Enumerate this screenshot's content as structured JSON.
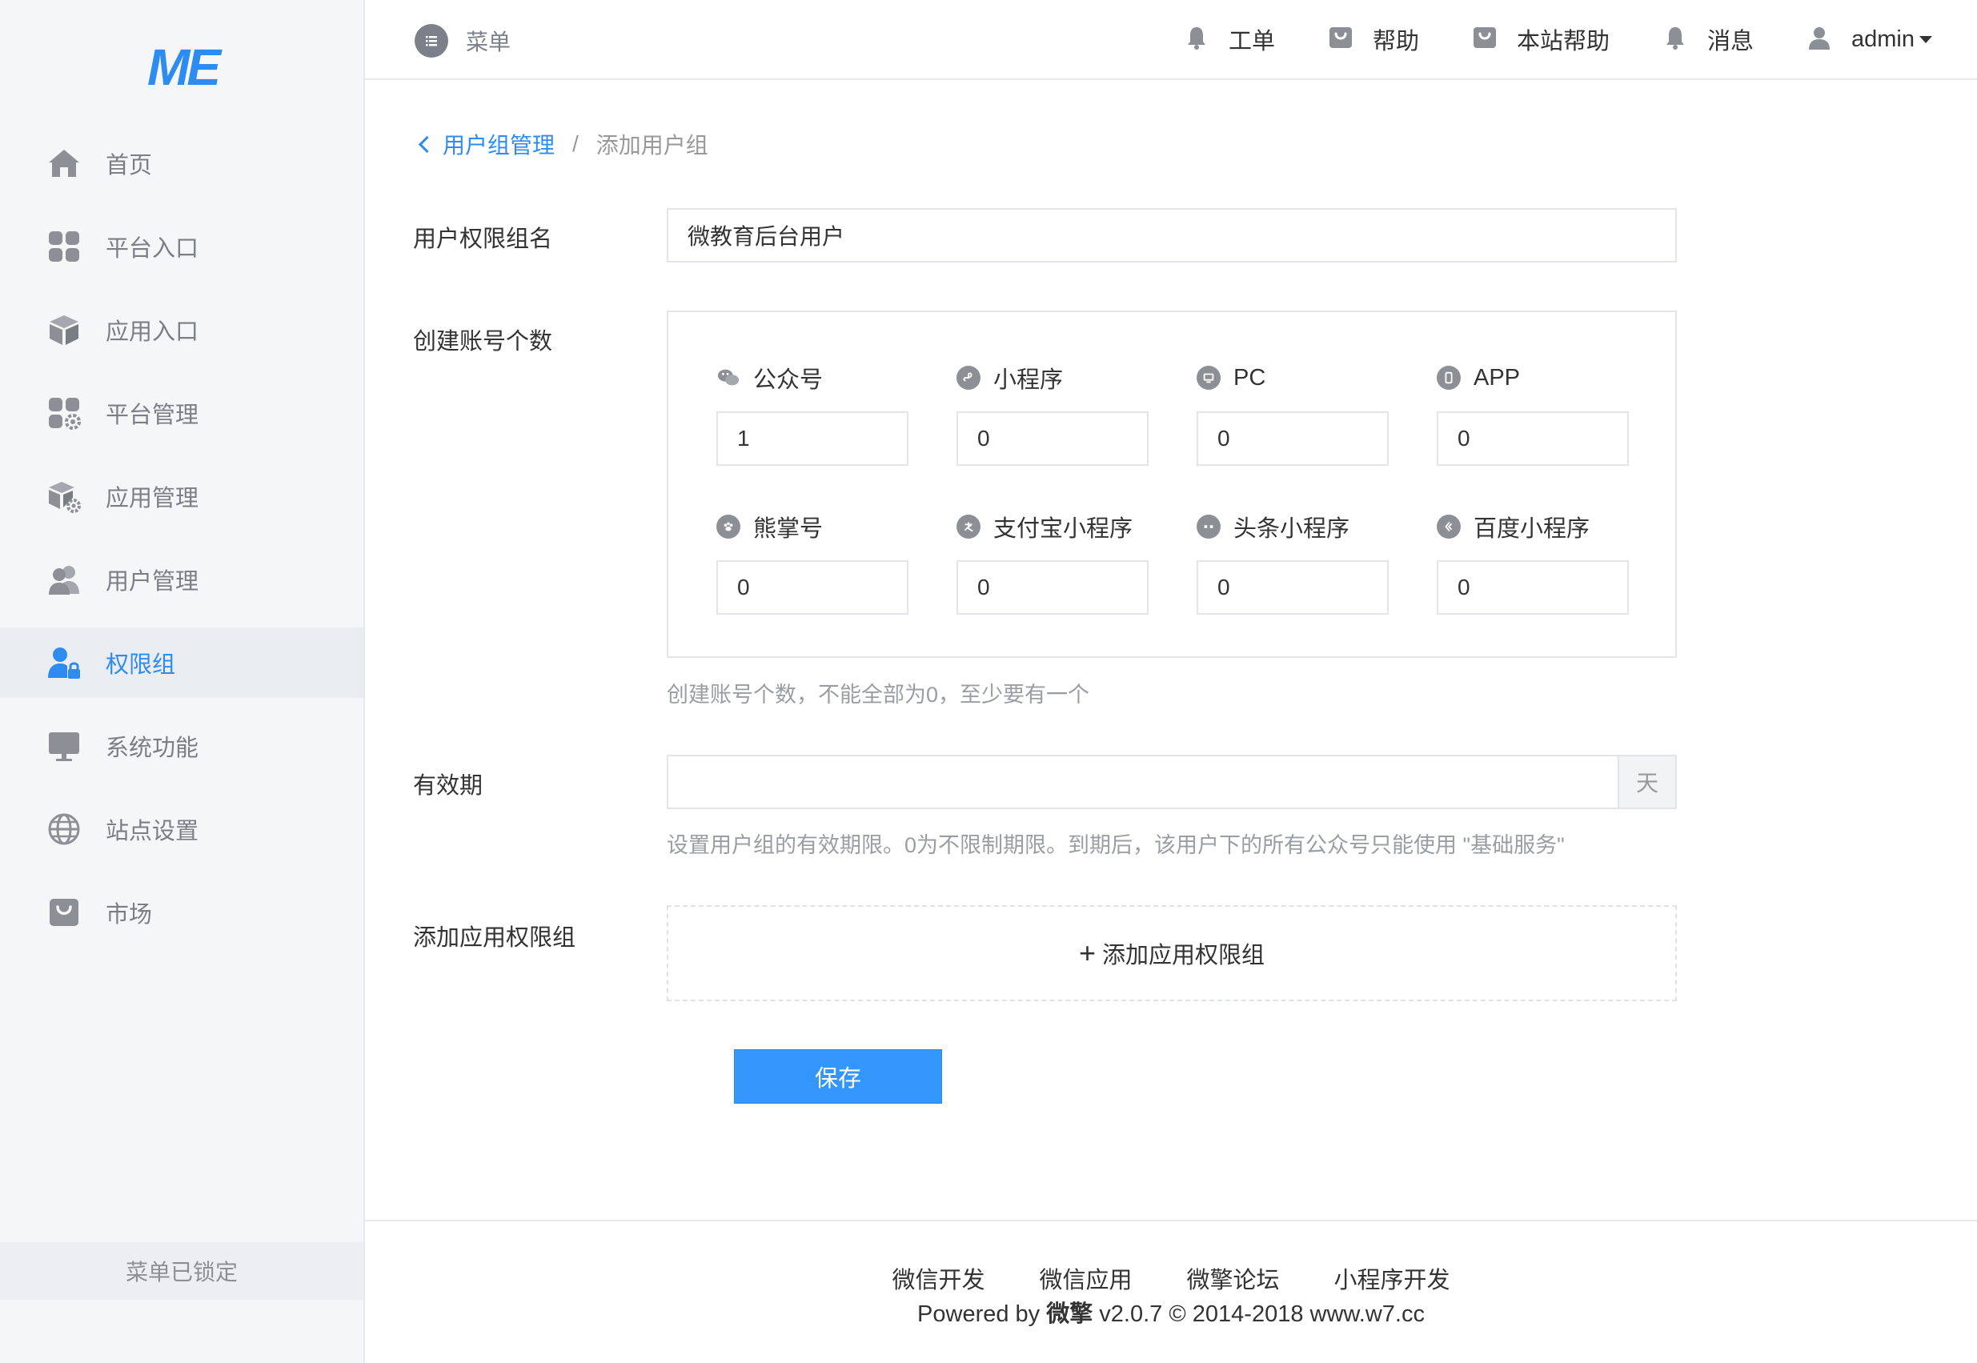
{
  "logo": {
    "text": "ME",
    "color": "#2e8cf0"
  },
  "sidebar": {
    "items": [
      {
        "label": "首页",
        "icon": "home-icon"
      },
      {
        "label": "平台入口",
        "icon": "grid-icon"
      },
      {
        "label": "应用入口",
        "icon": "cube-icon"
      },
      {
        "label": "平台管理",
        "icon": "grid-gear-icon"
      },
      {
        "label": "应用管理",
        "icon": "cube-gear-icon"
      },
      {
        "label": "用户管理",
        "icon": "users-icon"
      },
      {
        "label": "权限组",
        "icon": "user-lock-icon",
        "active": true
      },
      {
        "label": "系统功能",
        "icon": "monitor-icon"
      },
      {
        "label": "站点设置",
        "icon": "globe-icon"
      },
      {
        "label": "市场",
        "icon": "shop-bag-icon"
      }
    ],
    "lock_label": "菜单已锁定"
  },
  "header": {
    "menu_label": "菜单",
    "items": {
      "workorder": "工单",
      "help": "帮助",
      "site_help": "本站帮助",
      "messages": "消息",
      "user": "admin"
    }
  },
  "breadcrumb": {
    "parent": "用户组管理",
    "separator": "/",
    "current": "添加用户组"
  },
  "form": {
    "group_name": {
      "label": "用户权限组名",
      "value": "微教育后台用户"
    },
    "account_count": {
      "label": "创建账号个数",
      "accounts": [
        {
          "label": "公众号",
          "value": "1",
          "icon": "wechat-icon"
        },
        {
          "label": "小程序",
          "value": "0",
          "icon": "miniprogram-icon"
        },
        {
          "label": "PC",
          "value": "0",
          "icon": "pc-icon"
        },
        {
          "label": "APP",
          "value": "0",
          "icon": "app-icon"
        },
        {
          "label": "熊掌号",
          "value": "0",
          "icon": "paw-icon"
        },
        {
          "label": "支付宝小程序",
          "value": "0",
          "icon": "alipay-icon"
        },
        {
          "label": "头条小程序",
          "value": "0",
          "icon": "toutiao-icon"
        },
        {
          "label": "百度小程序",
          "value": "0",
          "icon": "baidu-icon"
        }
      ],
      "help": "创建账号个数，不能全部为0，至少要有一个"
    },
    "validity": {
      "label": "有效期",
      "value": "",
      "unit": "天",
      "help": "设置用户组的有效期限。0为不限制期限。到期后，该用户下的所有公众号只能使用 \"基础服务\""
    },
    "app_group": {
      "label": "添加应用权限组",
      "add_label": "添加应用权限组"
    },
    "save_label": "保存"
  },
  "footer": {
    "links": [
      "微信开发",
      "微信应用",
      "微擎论坛",
      "小程序开发"
    ],
    "powered_prefix": "Powered by ",
    "brand": "微擎",
    "powered_suffix": " v2.0.7 © 2014-2018 www.w7.cc"
  }
}
